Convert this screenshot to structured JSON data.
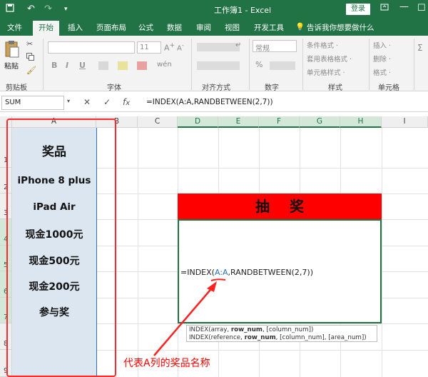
{
  "title_bar": {
    "title": "工作簿1  -  Excel",
    "login": "登录",
    "undo_icon": "undo-icon",
    "redo_icon": "redo-icon"
  },
  "ribbon_tabs": [
    "文件",
    "开始",
    "插入",
    "页面布局",
    "公式",
    "数据",
    "审阅",
    "视图",
    "开发工具"
  ],
  "active_tab": "开始",
  "tell_me": "告诉我你想要做什么",
  "ribbon": {
    "paste_label": "粘贴",
    "groups": [
      "剪贴板",
      "字体",
      "对齐方式",
      "数字",
      "样式",
      "单元格"
    ],
    "font_size": "11",
    "number_format": "常规",
    "styles": [
      "条件格式 ·",
      "套用表格格式 ·",
      "单元格样式 ·"
    ],
    "cells": [
      "插入 ·",
      "删除 ·",
      "格式 ·"
    ],
    "bold": "B",
    "italic": "I",
    "underline": "U",
    "percent": "%"
  },
  "formula_bar": {
    "name_box": "SUM",
    "formula": "=INDEX(A:A,RANDBETWEEN(2,7))"
  },
  "columns": [
    "A",
    "B",
    "C",
    "D",
    "E",
    "F",
    "G",
    "H",
    "I"
  ],
  "rows": [
    "1",
    "2",
    "3",
    "4",
    "5",
    "6",
    "7",
    "8",
    "9"
  ],
  "prizes": {
    "header": "奖品",
    "items": [
      "iPhone 8 plus",
      "iPad Air",
      "现金1000元",
      "现金500元",
      "现金200元",
      "参与奖"
    ]
  },
  "draw_title": "抽奖",
  "edit_formula": {
    "before": "=INDEX(",
    "ref": "A:A",
    "after": ",RANDBETWEEN(2,7))"
  },
  "tooltip": {
    "line1_pre": "INDEX(array, ",
    "line1_bold": "row_num",
    "line1_post": ", [column_num])",
    "line2_pre": "INDEX(reference, ",
    "line2_bold": "row_num",
    "line2_post": ", [column_num], [area_num])"
  },
  "annotation": "代表A列的奖品名称"
}
